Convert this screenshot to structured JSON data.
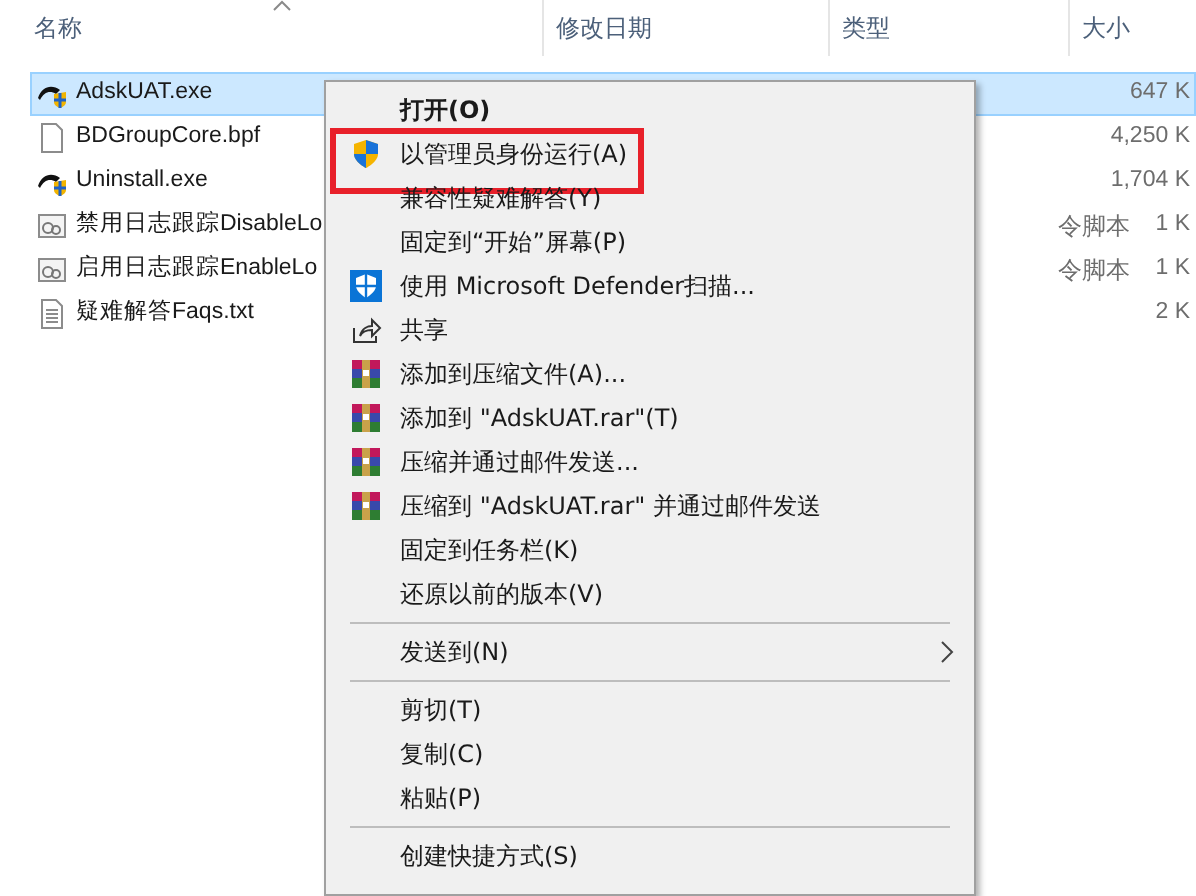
{
  "columns": [
    {
      "label": "名称",
      "sorted": true
    },
    {
      "label": "修改日期",
      "sorted": false
    },
    {
      "label": "类型",
      "sorted": false
    },
    {
      "label": "大小",
      "sorted": false
    }
  ],
  "files": [
    {
      "name": "AdskUAT.exe",
      "kind": "exe",
      "size": "647 K",
      "selected": true
    },
    {
      "name": "BDGroupCore.bpf",
      "kind": "file",
      "size": "4,250 K",
      "selected": false
    },
    {
      "name": "Uninstall.exe",
      "kind": "exe",
      "size": "1,704 K",
      "selected": false
    },
    {
      "name": "禁用日志跟踪DisableLo",
      "kind": "script",
      "type": "令脚本",
      "size": "1 K",
      "selected": false
    },
    {
      "name": "启用日志跟踪EnableLo",
      "kind": "script",
      "type": "令脚本",
      "size": "1 K",
      "selected": false
    },
    {
      "name": "疑难解答Faqs.txt",
      "kind": "text",
      "size": "2 K",
      "selected": false
    }
  ],
  "menu": [
    {
      "kind": "plain",
      "label": "打开(O)",
      "default": true
    },
    {
      "kind": "uac",
      "label": "以管理员身份运行(A)",
      "default": false,
      "highlighted": true
    },
    {
      "kind": "plain",
      "label": "兼容性疑难解答(Y)",
      "default": false
    },
    {
      "kind": "plain",
      "label": "固定到“开始”屏幕(P)",
      "default": false
    },
    {
      "kind": "defender",
      "label": "使用 Microsoft Defender扫描...",
      "default": false
    },
    {
      "kind": "share",
      "label": "共享",
      "default": false
    },
    {
      "kind": "archive",
      "label": "添加到压缩文件(A)...",
      "default": false
    },
    {
      "kind": "archive",
      "label": "添加到 \"AdskUAT.rar\"(T)",
      "default": false
    },
    {
      "kind": "archive",
      "label": "压缩并通过邮件发送...",
      "default": false
    },
    {
      "kind": "archive",
      "label": "压缩到 \"AdskUAT.rar\" 并通过邮件发送",
      "default": false
    },
    {
      "kind": "plain",
      "label": "固定到任务栏(K)",
      "default": false
    },
    {
      "kind": "plain",
      "label": "还原以前的版本(V)",
      "default": false
    },
    {
      "kind": "separator"
    },
    {
      "kind": "submenu",
      "label": "发送到(N)",
      "default": false
    },
    {
      "kind": "separator"
    },
    {
      "kind": "plain",
      "label": "剪切(T)",
      "default": false
    },
    {
      "kind": "plain",
      "label": "复制(C)",
      "default": false
    },
    {
      "kind": "plain",
      "label": "粘贴(P)",
      "default": false
    },
    {
      "kind": "separator"
    },
    {
      "kind": "plain",
      "label": "创建快捷方式(S)",
      "default": false
    }
  ]
}
